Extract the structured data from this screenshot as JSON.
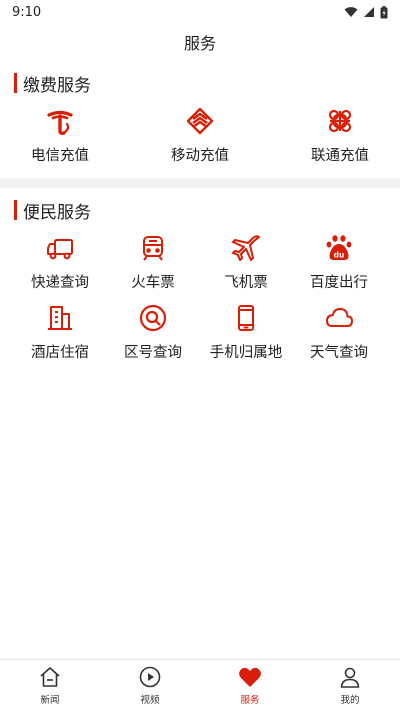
{
  "status_bar": {
    "time": "9:10"
  },
  "header": {
    "title": "服务"
  },
  "sections": [
    {
      "title": "缴费服务",
      "items": [
        {
          "label": "电信充值",
          "icon": "telecom-icon"
        },
        {
          "label": "移动充值",
          "icon": "mobile-icon"
        },
        {
          "label": "联通充值",
          "icon": "unicom-icon"
        }
      ]
    },
    {
      "title": "便民服务",
      "items": [
        {
          "label": "快递查询",
          "icon": "truck-icon"
        },
        {
          "label": "火车票",
          "icon": "train-icon"
        },
        {
          "label": "飞机票",
          "icon": "airplane-icon"
        },
        {
          "label": "百度出行",
          "icon": "baidu-icon"
        },
        {
          "label": "酒店住宿",
          "icon": "hotel-icon"
        },
        {
          "label": "区号查询",
          "icon": "search-icon"
        },
        {
          "label": "手机归属地",
          "icon": "phone-icon"
        },
        {
          "label": "天气查询",
          "icon": "cloud-icon"
        }
      ]
    }
  ],
  "tabs": [
    {
      "label": "新闻",
      "icon": "home-icon",
      "active": false
    },
    {
      "label": "视频",
      "icon": "play-icon",
      "active": false
    },
    {
      "label": "服务",
      "icon": "heart-icon",
      "active": true
    },
    {
      "label": "我的",
      "icon": "user-icon",
      "active": false
    }
  ],
  "colors": {
    "accent": "#d81e06",
    "divider": "#f2f2f2",
    "text": "#222222"
  }
}
